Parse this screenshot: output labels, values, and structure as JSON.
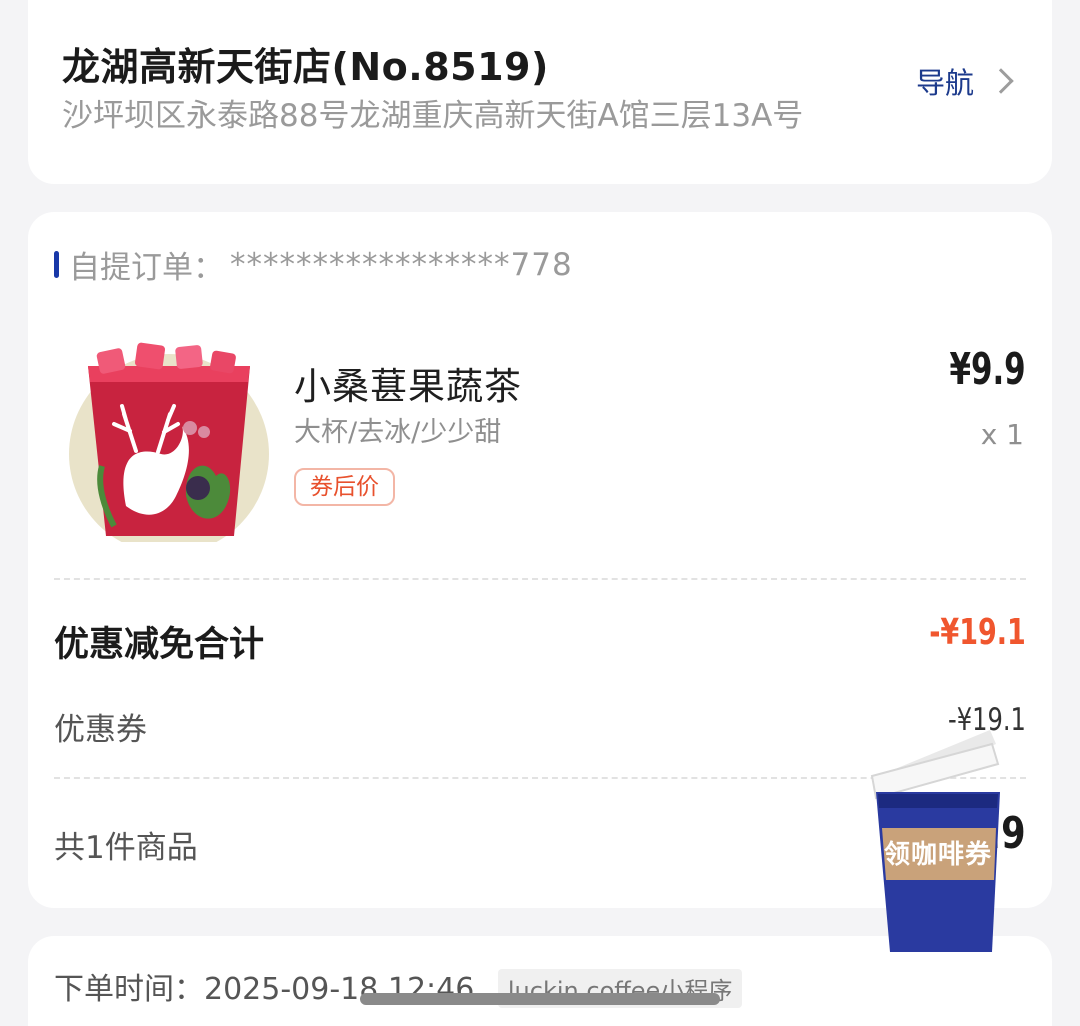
{
  "store": {
    "name": "龙湖高新天街店(No.8519)",
    "address": "沙坪坝区永泰路88号龙湖重庆高新天街A馆三层13A号",
    "nav_label": "导航"
  },
  "order": {
    "label": "自提订单：",
    "number": "*****************778",
    "product": {
      "name": "小桑葚果蔬茶",
      "spec": "大杯/去冰/少少甜",
      "tag": "券后价",
      "price": "¥9.9",
      "qty": "x 1"
    },
    "discount_total_label": "优惠减免合计",
    "discount_total_value": "-¥19.1",
    "coupon_label": "优惠券",
    "coupon_value": "-¥19.1",
    "items_label": "共1件商品",
    "items_total": "¥9.9"
  },
  "meta": {
    "order_time": "下单时间：2025-09-18 12:46",
    "source": "luckin coffee小程序"
  },
  "fab": {
    "label": "领咖啡券"
  },
  "colors": {
    "accent_blue": "#1838a8",
    "discount_red": "#f0562e"
  }
}
